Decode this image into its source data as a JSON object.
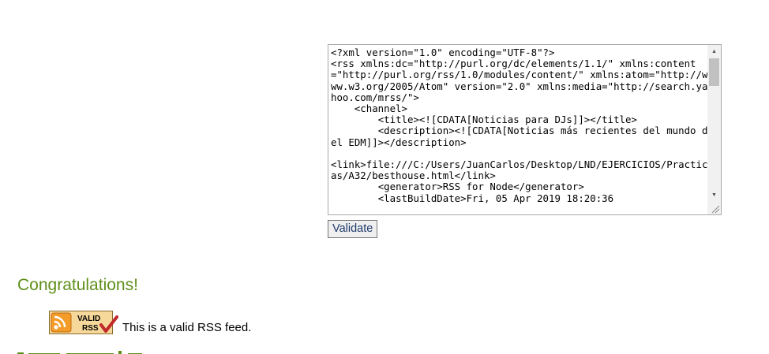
{
  "xml_source": {
    "content": "<?xml version=\"1.0\" encoding=\"UTF-8\"?>\n<rss xmlns:dc=\"http://purl.org/dc/elements/1.1/\" xmlns:content=\"http://purl.org/rss/1.0/modules/content/\" xmlns:atom=\"http://www.w3.org/2005/Atom\" version=\"2.0\" xmlns:media=\"http://search.yahoo.com/mrss/\">\n    <channel>\n        <title><![CDATA[Noticias para DJs]]></title>\n        <description><![CDATA[Noticias más recientes del mundo del EDM]]></description>\n\n<link>file:///C:/Users/JuanCarlos/Desktop/LND/EJERCICIOS/Practicas/A32/besthouse.html</link>\n        <generator>RSS for Node</generator>\n        <lastBuildDate>Fri, 05 Apr 2019 18:20:36"
  },
  "form": {
    "validate_label": "Validate"
  },
  "result": {
    "heading": "Congratulations!",
    "badge_line1": "VALID",
    "badge_line2": "RSS",
    "message": "This is a valid RSS feed.",
    "colors": {
      "heading": "#5f8f1a",
      "badge_orange": "#f39c2a",
      "check_red": "#c0282a"
    }
  }
}
